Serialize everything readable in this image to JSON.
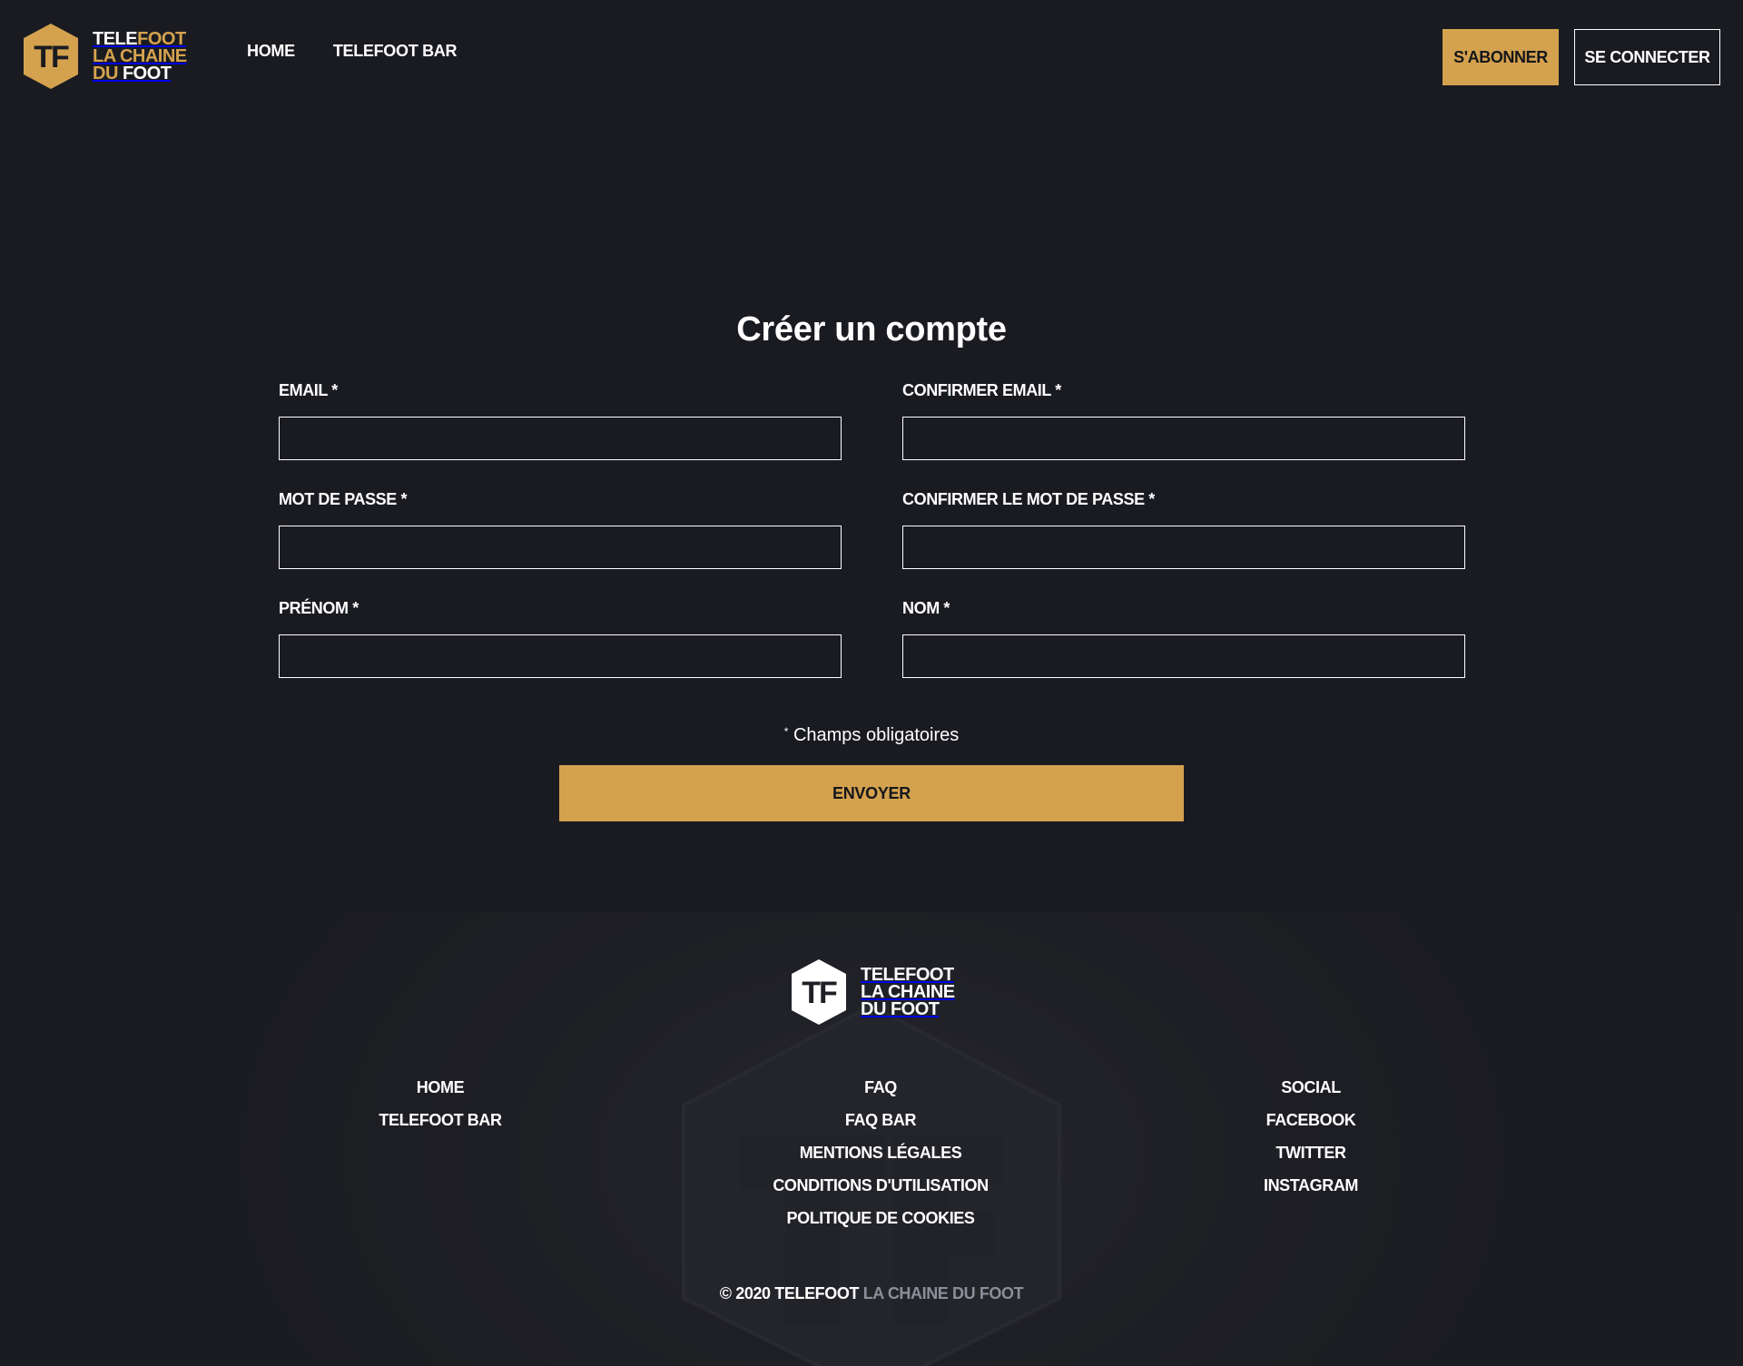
{
  "header": {
    "logo": {
      "monogram": "TF",
      "line1_white": "TELE",
      "line1_gold": "FOOT",
      "line2": "LA CHAINE",
      "line3_white": "DU",
      "line3_gold": "FOOT"
    },
    "nav": [
      {
        "label": "HOME"
      },
      {
        "label": "TELEFOOT BAR"
      }
    ],
    "subscribe_label": "S'ABONNER",
    "login_label": "SE CONNECTER"
  },
  "form": {
    "title": "Créer un compte",
    "fields": {
      "email": {
        "label": "EMAIL *",
        "value": ""
      },
      "confirm_email": {
        "label": "CONFIRMER EMAIL *",
        "value": ""
      },
      "password": {
        "label": "MOT DE PASSE *",
        "value": ""
      },
      "confirm_password": {
        "label": "CONFIRMER LE MOT DE PASSE *",
        "value": ""
      },
      "first_name": {
        "label": "PRÉNOM *",
        "value": ""
      },
      "last_name": {
        "label": "NOM *",
        "value": ""
      }
    },
    "required_mark": "*",
    "required_note": " Champs obligatoires",
    "submit_label": "ENVOYER"
  },
  "footer": {
    "logo": {
      "monogram": "TF",
      "line1": "TELEFOOT",
      "line2": "LA CHAINE",
      "line3": "DU FOOT"
    },
    "col1": [
      "HOME",
      "TELEFOOT BAR"
    ],
    "col2": [
      "FAQ",
      "FAQ BAR",
      "MENTIONS LÉGALES",
      "CONDITIONS D'UTILISATION",
      "POLITIQUE DE COOKIES"
    ],
    "col3_title": "SOCIAL",
    "col3": [
      "FACEBOOK",
      "TWITTER",
      "INSTAGRAM"
    ],
    "copyright_main": "© 2020 TELEFOOT",
    "copyright_muted": "LA CHAINE DU FOOT"
  },
  "colors": {
    "background": "#1a1b21",
    "accent": "#d4a24e",
    "text": "#ffffff",
    "muted": "#8a8f99"
  }
}
